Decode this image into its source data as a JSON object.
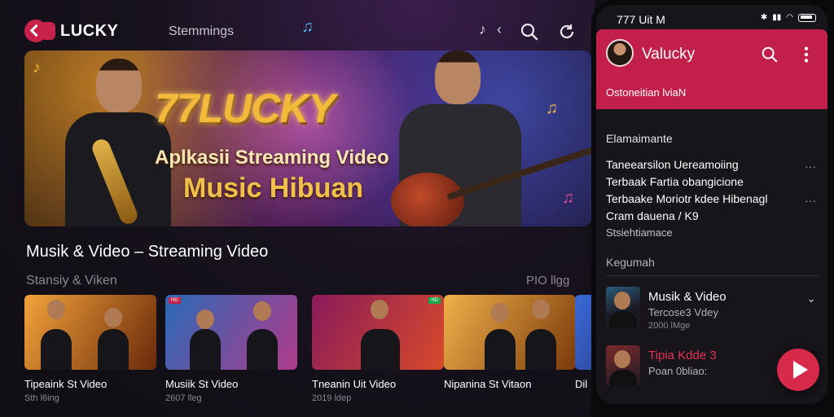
{
  "app": {
    "logo_text": "LUCKY",
    "nav_title": "Stemmings"
  },
  "banner": {
    "brand": "77LUCKY",
    "line1": "Aplkasii Streaming Video",
    "line2": "Music Hibuan"
  },
  "section": {
    "title": "Musik & Video – Streaming Video",
    "subtitle_left": "Stansiy & Viken",
    "subtitle_right": "PIO llgg"
  },
  "cards": [
    {
      "title": "Tipeaink St Video",
      "meta": "Sth l6ing"
    },
    {
      "title": "Musiik St Video",
      "meta": "2607 lleg"
    },
    {
      "title": "Tneanin Uit Video",
      "meta": "2019 ldep"
    },
    {
      "title": "Nipanina St Vitaon",
      "meta": ""
    },
    {
      "title": "Dil",
      "meta": ""
    }
  ],
  "phone": {
    "status_time": "777 Uit M",
    "app_name": "Valucky",
    "header_banner": "Ostoneitian lviaN",
    "section1_label": "Elamaimante",
    "lines": [
      "Taneearsilon Uereamoiing",
      "Terbaak  Fartia obangicione",
      "Terbaake Moriotr  kdee Hibenagl",
      "Cram dauena / K9",
      "Stsiehtiamace"
    ],
    "section2_label": "Kegumah",
    "list": [
      {
        "title": "Musik & Video",
        "sub": "Tercose3 Vdey",
        "sub2": "2000 lMge"
      },
      {
        "title": "Tipia Kdde 3",
        "sub": "Poan 0bliao:",
        "sub2": ""
      }
    ]
  },
  "colors": {
    "accent": "#c21f4b",
    "fab": "#d72a4a",
    "background": "#121016"
  }
}
